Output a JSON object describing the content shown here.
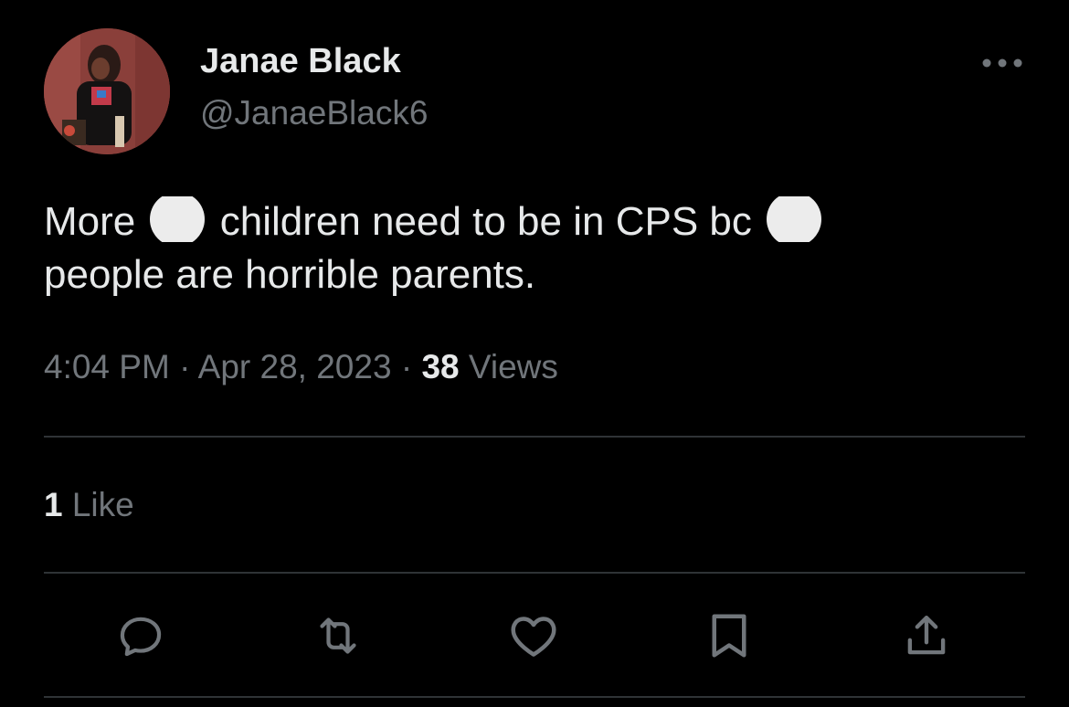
{
  "author": {
    "display_name": "Janae Black",
    "handle": "@JanaeBlack6",
    "avatar": "profile-photo"
  },
  "tweet": {
    "text_part1": "More",
    "text_part2": "children need to be in CPS bc",
    "text_part3": "people are horrible parents.",
    "emoji": "white-circle-emoji"
  },
  "meta": {
    "time": "4:04 PM",
    "separator": "·",
    "date": "Apr 28, 2023",
    "views_count": "38",
    "views_label": "Views"
  },
  "stats": {
    "likes_count": "1",
    "likes_label": "Like"
  },
  "actions": [
    {
      "icon": "reply-icon"
    },
    {
      "icon": "retweet-icon"
    },
    {
      "icon": "like-icon"
    },
    {
      "icon": "bookmark-icon"
    },
    {
      "icon": "share-icon"
    }
  ],
  "colors": {
    "background": "#000000",
    "primary_text": "#e7e9ea",
    "secondary_text": "#71767b",
    "divider": "#2f3336"
  }
}
